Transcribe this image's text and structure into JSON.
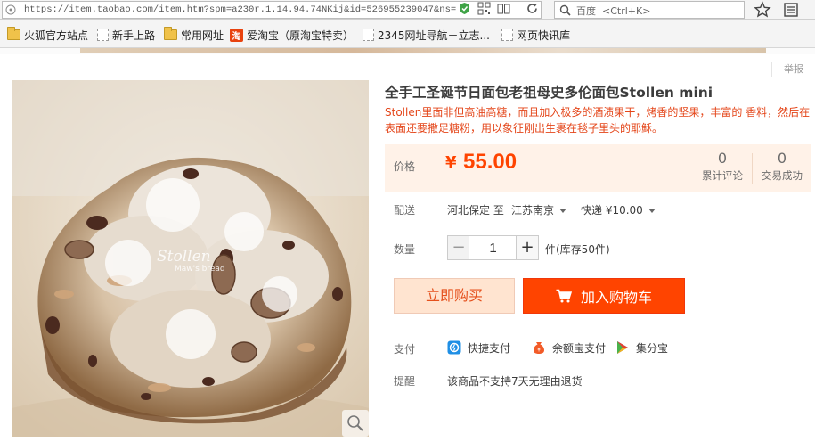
{
  "browser": {
    "url": "https://item.taobao.com/item.htm?spm=a230r.1.14.94.74NKij&id=526955239047&ns=",
    "search_engine": "百度",
    "search_shortcut": "<Ctrl+K>"
  },
  "bookmarks": [
    {
      "label": "火狐官方站点",
      "icon": "folder-icon"
    },
    {
      "label": "新手上路",
      "icon": "page-icon"
    },
    {
      "label": "常用网址",
      "icon": "folder-icon"
    },
    {
      "label": "爱淘宝（原淘宝特卖）",
      "icon": "taobao-icon"
    },
    {
      "label": "2345网址导航－立志...",
      "icon": "page-icon"
    },
    {
      "label": "网页快讯库",
      "icon": "page-icon"
    }
  ],
  "page": {
    "report_label": "举报"
  },
  "image": {
    "watermark_1": "Stollen",
    "watermark_2": "Maw's bread"
  },
  "product": {
    "title": "全手工圣诞节日面包老祖母史多伦面包Stollen mini",
    "subtitle": "Stollen里面非但高油高糖，而且加入极多的酒渍果干，烤香的坚果，丰富的 香料，然后在表面还要撒足糖粉，用以象征刚出生裹在毯子里头的耶稣。",
    "price_label": "价格",
    "currency": "¥",
    "price": "55.00",
    "price_color": "#ff4400",
    "reviews_count": "0",
    "reviews_label": "累计评论",
    "sales_count": "0",
    "sales_label": "交易成功"
  },
  "shipping": {
    "label": "配送",
    "origin": "河北保定 至",
    "destination": "江苏南京",
    "method": "快递 ¥10.00"
  },
  "quantity": {
    "label": "数量",
    "minus": "−",
    "value": "1",
    "plus": "+",
    "stock_text": "件(库存50件)"
  },
  "actions": {
    "buy_now": "立即购买",
    "add_to_cart": "加入购物车"
  },
  "payment": {
    "label": "支付",
    "methods": [
      {
        "label": "快捷支付",
        "icon": "quickpay-icon"
      },
      {
        "label": "余额宝支付",
        "icon": "yuebao-icon"
      },
      {
        "label": "集分宝",
        "icon": "jifenbao-icon"
      }
    ]
  },
  "reminder": {
    "label": "提醒",
    "text": "该商品不支持7天无理由退货"
  }
}
